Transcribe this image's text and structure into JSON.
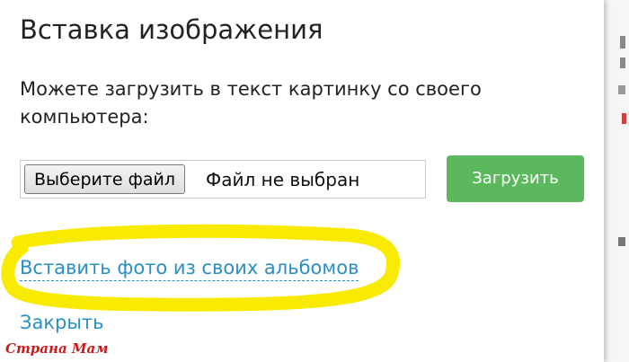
{
  "dialog": {
    "title": "Вставка изображения",
    "description": "Можете загрузить в текст картинку со своего компьютера:",
    "file_input": {
      "button_label": "Выберите файл",
      "status": "Файл не выбран"
    },
    "upload_label": "Загрузить",
    "albums_link": "Вставить фото из своих альбомов",
    "close_link": "Закрыть"
  },
  "watermark": "Страна Мам",
  "colors": {
    "link": "#2a8fc4",
    "upload_button": "#5cb85c",
    "highlight": "#f8ea00",
    "watermark": "#cc1a1a"
  },
  "icons": []
}
